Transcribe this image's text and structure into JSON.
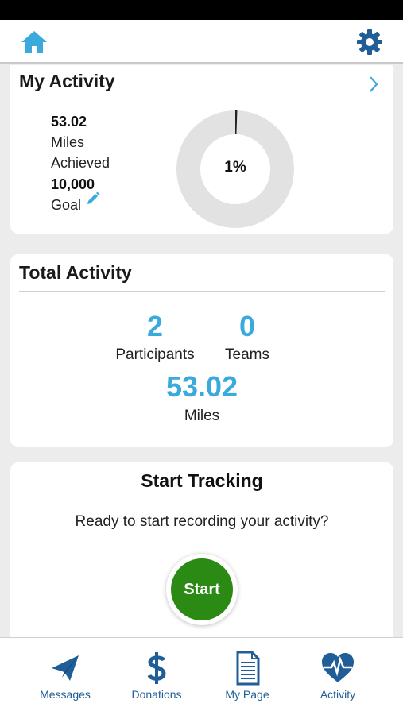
{
  "header": {
    "home_icon": "home-icon",
    "settings_icon": "gear-icon"
  },
  "my_activity": {
    "title": "My Activity",
    "miles_value": "53.02",
    "miles_label_1": "Miles",
    "miles_label_2": "Achieved",
    "goal_value": "10,000",
    "goal_label": "Goal",
    "progress_label": "1%",
    "progress_fraction": 0.0053
  },
  "total_activity": {
    "title": "Total Activity",
    "participants_value": "2",
    "participants_label": "Participants",
    "teams_value": "0",
    "teams_label": "Teams",
    "miles_value": "53.02",
    "miles_label": "Miles"
  },
  "start_tracking": {
    "title": "Start Tracking",
    "prompt": "Ready to start recording your activity?",
    "button_label": "Start"
  },
  "nav": {
    "items": [
      {
        "label": "Messages",
        "icon": "paper-plane-icon"
      },
      {
        "label": "Donations",
        "icon": "dollar-icon"
      },
      {
        "label": "My Page",
        "icon": "document-icon"
      },
      {
        "label": "Activity",
        "icon": "heart-pulse-icon"
      }
    ]
  },
  "colors": {
    "accent": "#3aa9dc",
    "nav_blue": "#1f5e96",
    "start_green": "#2a8a14",
    "donut_track": "#e2e2e2"
  }
}
